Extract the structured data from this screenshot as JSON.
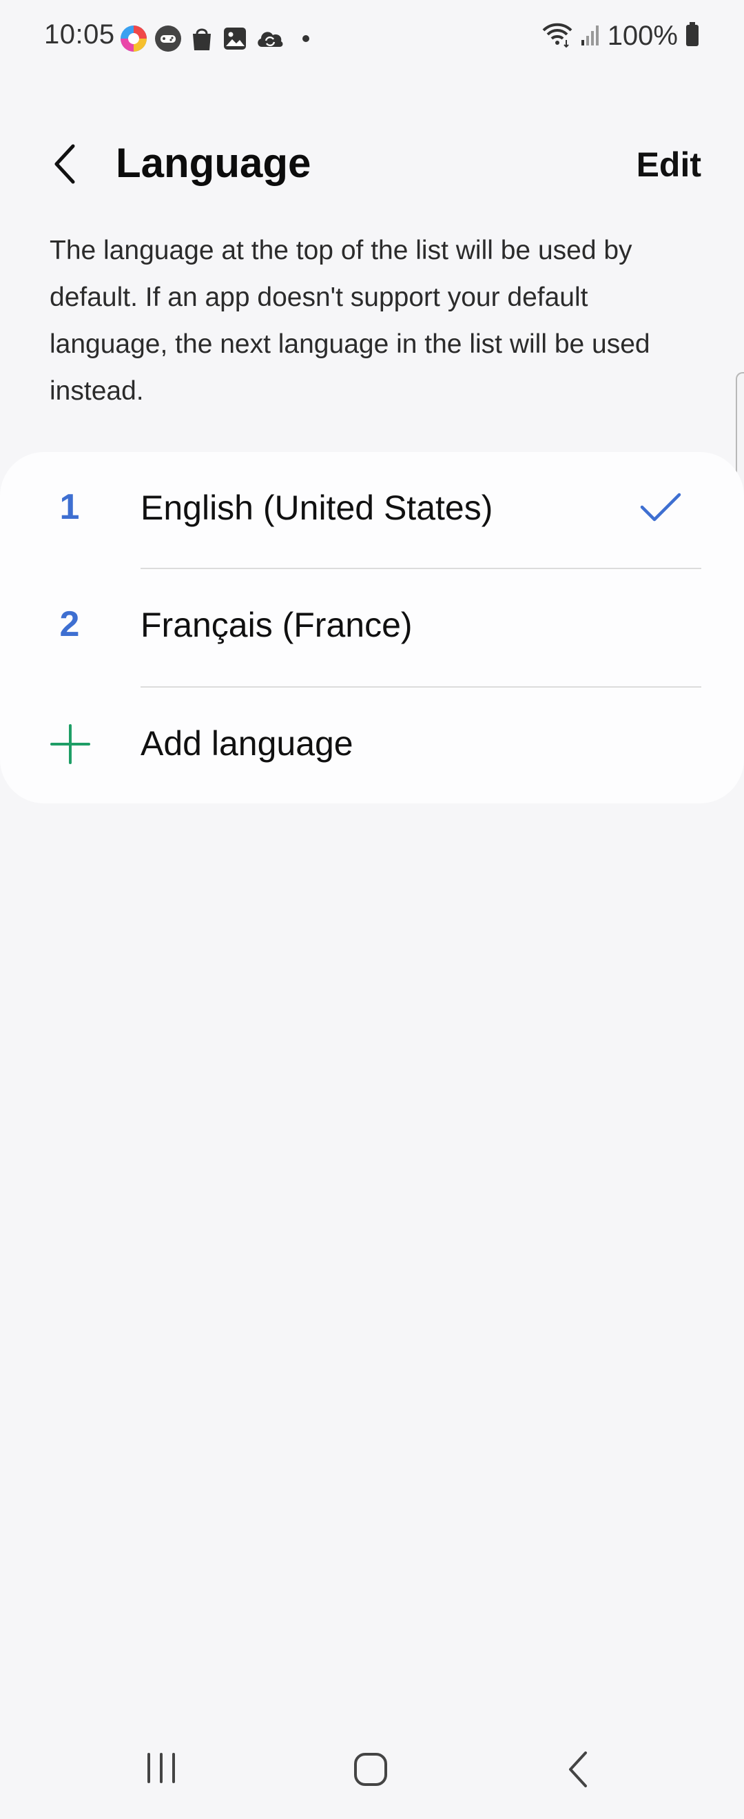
{
  "status_bar": {
    "time": "10:05",
    "battery": "100%",
    "notification_icons": [
      "color-app-icon",
      "game-icon",
      "shopping-bag-icon",
      "gallery-icon",
      "cloud-sync-icon",
      "more-dot-icon"
    ],
    "system_icons": [
      "wifi-icon",
      "signal-icon",
      "battery-icon"
    ]
  },
  "header": {
    "back_icon": "chevron-left-icon",
    "title": "Language",
    "edit_label": "Edit"
  },
  "description": "The language at the top of the list will be used by default. If an app doesn't support your default language, the next language in the list will be used instead.",
  "languages": [
    {
      "rank": "1",
      "name": "English (United States)",
      "selected": true
    },
    {
      "rank": "2",
      "name": "Français (France)",
      "selected": false
    }
  ],
  "add_language_label": "Add language",
  "colors": {
    "accent_blue": "#3e6fd1",
    "add_green": "#1e9e66",
    "background": "#f6f6f8",
    "card": "#fdfdfe"
  },
  "nav_bar": {
    "items": [
      "recents-icon",
      "home-icon",
      "back-icon"
    ]
  }
}
